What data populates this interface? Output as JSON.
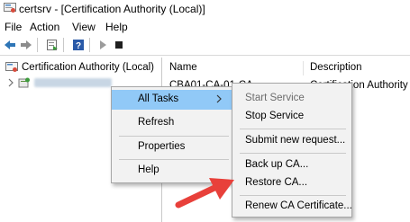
{
  "window": {
    "title": "certsrv - [Certification Authority (Local)]",
    "icon": "certsrv-app-icon"
  },
  "menubar": {
    "items": [
      "File",
      "Action",
      "View",
      "Help"
    ]
  },
  "toolbar": {
    "icons": [
      "back-arrow-icon",
      "forward-arrow-icon",
      "properties-icon",
      "help-icon",
      "start-service-icon",
      "stop-service-icon"
    ]
  },
  "tree": {
    "root_label": "Certification Authority (Local)",
    "child_label_redacted": true
  },
  "list": {
    "columns": [
      "Name",
      "Description"
    ],
    "row": {
      "name": "CBA01-CA-01-CA",
      "description": "Certification Authority"
    }
  },
  "context_menu": {
    "items": [
      {
        "label": "All Tasks",
        "highlighted": true,
        "submenu": true
      },
      {
        "label": "Refresh"
      },
      {
        "label": "Properties"
      },
      {
        "label": "Help"
      }
    ]
  },
  "submenu": {
    "items": [
      {
        "label": "Start Service",
        "disabled": true
      },
      {
        "label": "Stop Service"
      },
      {
        "label": "Submit new request..."
      },
      {
        "label": "Back up CA..."
      },
      {
        "label": "Restore CA..."
      },
      {
        "label": "Renew CA Certificate..."
      }
    ]
  },
  "colors": {
    "highlight": "#91c9f7",
    "menu_bg": "#f2f2f2",
    "annotation_arrow": "#e8403a",
    "toolbar_arrow": "#2e75b6"
  }
}
